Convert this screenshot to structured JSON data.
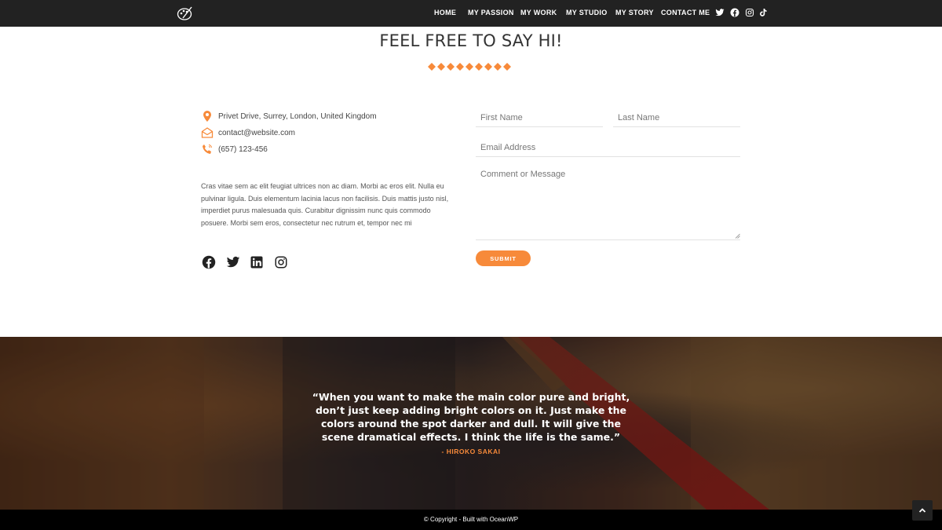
{
  "header": {
    "nav": [
      {
        "label": "HOME"
      },
      {
        "label": "MY PASSION"
      },
      {
        "label": "MY WORK"
      },
      {
        "label": "MY STUDIO"
      },
      {
        "label": "MY STORY"
      },
      {
        "label": "CONTACT ME"
      }
    ],
    "social_icons": [
      "twitter-icon",
      "facebook-icon",
      "instagram-icon",
      "tiktok-icon"
    ]
  },
  "page": {
    "title": "FEEL FREE TO SAY HI!",
    "accent_color": "#f78a3a"
  },
  "contact": {
    "address": "Privet Drive, Surrey, London, United Kingdom",
    "email": "contact@website.com",
    "phone": "(657) 123-456",
    "description": "Cras vitae sem ac elit feugiat ultrices non ac diam. Morbi ac eros elit. Nulla eu pulvinar ligula. Duis elementum lacinia lacus non facilisis. Duis mattis justo nisl, imperdiet purus malesuada quis. Curabitur dignissim nunc quis commodo posuere. Morbi sem eros, consectetur nec rutrum et, tempor nec mi",
    "social_icons": [
      "facebook-icon",
      "twitter-icon",
      "linkedin-icon",
      "instagram-icon"
    ]
  },
  "form": {
    "first_name_placeholder": "First Name",
    "last_name_placeholder": "Last Name",
    "email_placeholder": "Email Address",
    "message_placeholder": "Comment or Message",
    "submit_label": "SUBMIT"
  },
  "quote": {
    "text": "“When you want to make the main color pure and bright, don’t just keep adding bright colors on it. Just make the colors around the spot darker and dull. It will give the scene dramatical effects. I think the life is the same.”",
    "author": "- HIROKO SAKAI"
  },
  "footer": {
    "copyright": "© Copyright - Built with OceanWP"
  }
}
